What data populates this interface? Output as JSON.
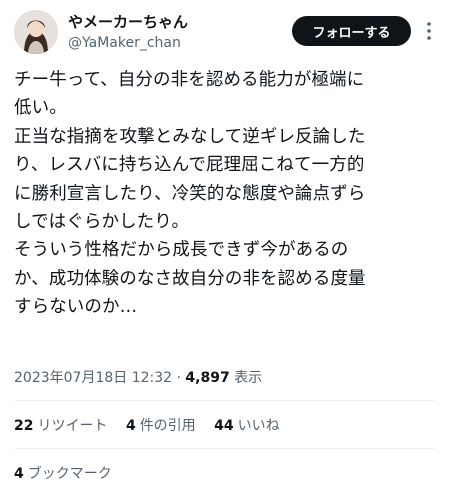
{
  "author": {
    "display_name": "やメーカーちゃん",
    "handle": "@YaMaker_chan"
  },
  "follow_button_label": "フォローする",
  "tweet": {
    "lines": [
      "チー牛って、自分の非を認める能力が極端に",
      "低い。",
      "正当な指摘を攻撃とみなして逆ギレ反論した",
      "り、レスバに持ち込んで屁理屈こねて一方的",
      "に勝利宣言したり、冷笑的な態度や論点ずら",
      "しではぐらかしたり。",
      "そういう性格だから成長できず今があるの",
      "か、成功体験のなさ故自分の非を認める度量",
      "すらないのか…"
    ]
  },
  "meta": {
    "timestamp": "2023年07月18日 12:32",
    "separator": " · ",
    "views_count": "4,897",
    "views_label": "表示"
  },
  "stats": {
    "retweets_count": "22",
    "retweets_label": "リツイート",
    "quotes_count": "4",
    "quotes_label": "件の引用",
    "likes_count": "44",
    "likes_label": "いいね",
    "bookmarks_count": "4",
    "bookmarks_label": "ブックマーク"
  },
  "icons": {
    "more": "more-dots-icon",
    "avatar": "user-avatar"
  },
  "colors": {
    "text_primary": "#0f1419",
    "text_secondary": "#536471",
    "follow_button_bg": "#0f1419",
    "divider": "#eff3f4"
  }
}
